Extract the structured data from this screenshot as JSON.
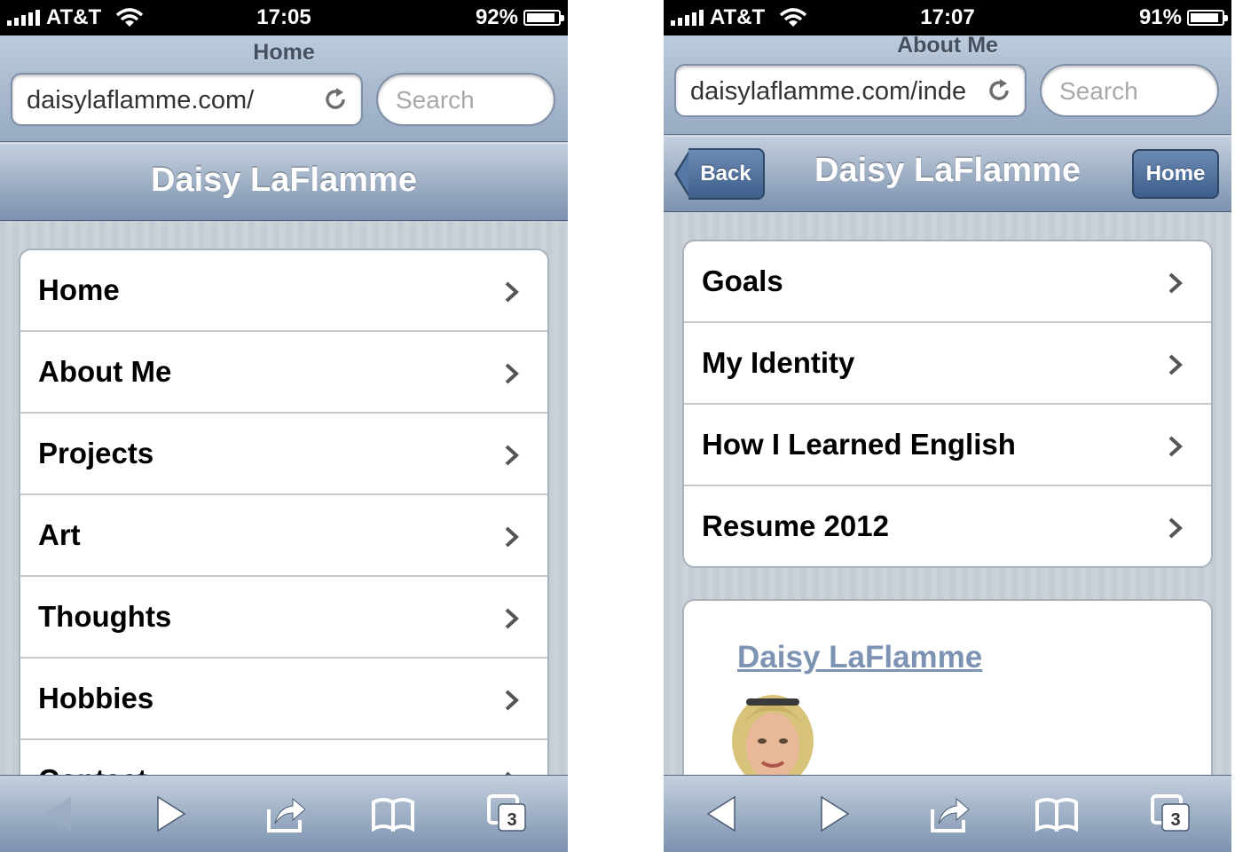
{
  "left_screen": {
    "status": {
      "carrier": "AT&T",
      "time": "17:05",
      "battery": "92%",
      "battery_level": 0.92
    },
    "browser": {
      "page_title": "Home",
      "url": "daisylaflamme.com/",
      "search_placeholder": "Search"
    },
    "header": {
      "title": "Daisy LaFlamme"
    },
    "list": [
      {
        "label": "Home"
      },
      {
        "label": "About Me"
      },
      {
        "label": "Projects"
      },
      {
        "label": "Art"
      },
      {
        "label": "Thoughts"
      },
      {
        "label": "Hobbies"
      },
      {
        "label": "Contact"
      }
    ],
    "toolbar": {
      "tab_count": "3",
      "back_enabled": false
    },
    "icons": [
      "signal-icon",
      "wifi-icon",
      "battery-icon",
      "reload-icon",
      "chevron-right-icon",
      "back-arrow-icon",
      "forward-arrow-icon",
      "share-icon",
      "bookmarks-icon",
      "tabs-icon"
    ]
  },
  "right_screen": {
    "status": {
      "carrier": "AT&T",
      "time": "17:07",
      "battery": "91%",
      "battery_level": 0.91
    },
    "browser": {
      "page_title": "About Me",
      "url": "daisylaflamme.com/inde",
      "search_placeholder": "Search"
    },
    "header": {
      "title": "Daisy LaFlamme",
      "back_label": "Back",
      "home_label": "Home"
    },
    "list": [
      {
        "label": "Goals"
      },
      {
        "label": "My Identity"
      },
      {
        "label": "How I Learned English"
      },
      {
        "label": "Resume 2012"
      }
    ],
    "card": {
      "link": "Daisy LaFlamme"
    },
    "toolbar": {
      "tab_count": "3",
      "back_enabled": true
    }
  },
  "colors": {
    "header_gradient_top": "#c3cfdd",
    "header_gradient_bottom": "#7c92af",
    "button_blue": "#4b6c98",
    "link_color": "#7d93b3",
    "striped_background": "#c5ccd4"
  }
}
